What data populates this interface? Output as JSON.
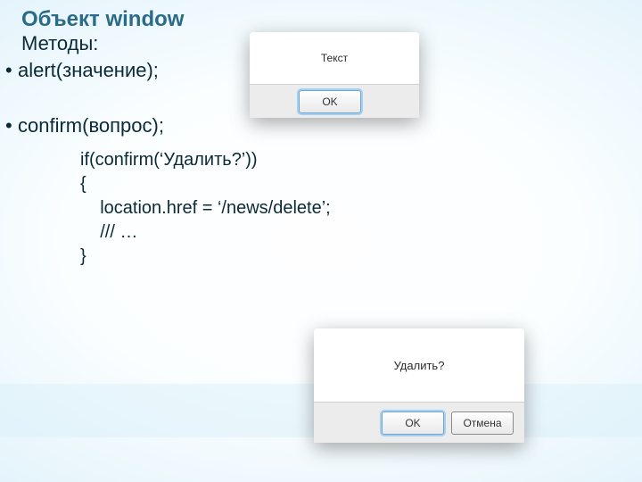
{
  "title": "Объект window",
  "subtitle": "Методы:",
  "bullets": {
    "first": "alert(значение);",
    "second": "confirm(вопрос);"
  },
  "code": {
    "l1": "if(confirm(‘Удалить?’))",
    "l2": "{",
    "l3": "    location.href = ‘/news/delete’;",
    "l4": "    /// …",
    "l5": "}"
  },
  "alert_dialog": {
    "message": "Текст",
    "ok_label": "OK"
  },
  "confirm_dialog": {
    "message": "Удалить?",
    "ok_label": "OK",
    "cancel_label": "Отмена"
  }
}
